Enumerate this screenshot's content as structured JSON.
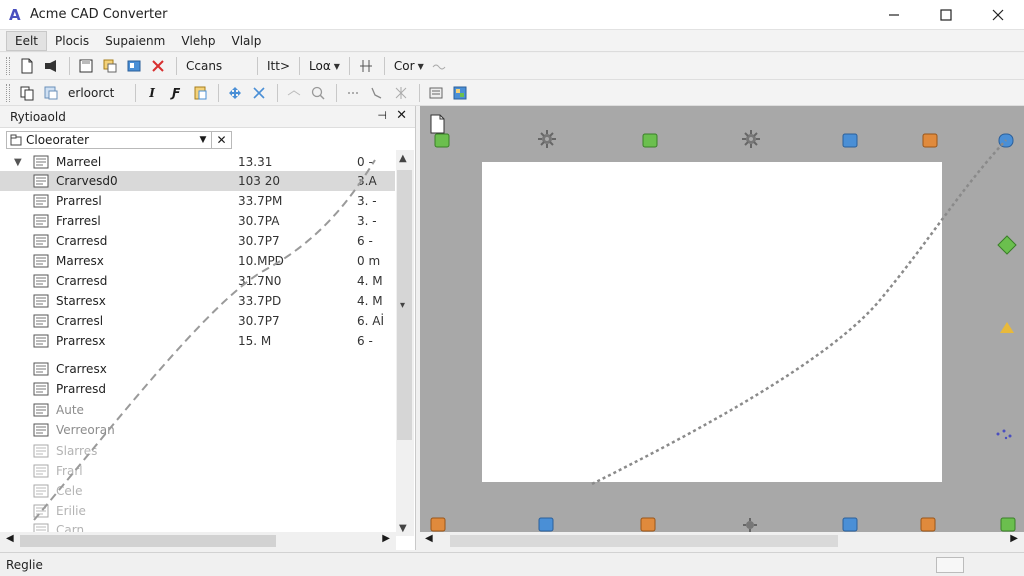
{
  "window": {
    "title": "Acme CAD Converter",
    "logo_glyph": "A",
    "accent": "#4a4fbf"
  },
  "menu": [
    {
      "label": "Eelt",
      "active": true
    },
    {
      "label": "Plocis"
    },
    {
      "label": "Supaienm"
    },
    {
      "label": "Vlehp"
    },
    {
      "label": "Vlalp"
    }
  ],
  "toolbar1": {
    "scans_label": "Ccans",
    "itt_label": "Itt>",
    "log_label": "Loα",
    "cor_label": "Cor"
  },
  "toolbar2": {
    "convert_label": "erloorct"
  },
  "panel": {
    "title": "Rytioaold",
    "combo_value": "Cloeorater"
  },
  "files": [
    {
      "name": "Marreel",
      "size": "13.31",
      "date": "0 –",
      "expander": "▼"
    },
    {
      "name": "Crarvesd0",
      "size": "103 20",
      "date": "3.A",
      "selected": true
    },
    {
      "name": "Prarresl",
      "size": "33.7PM",
      "date": "3. -"
    },
    {
      "name": "Frarresl",
      "size": "30.7PA",
      "date": "3. -"
    },
    {
      "name": "Crarresd",
      "size": "30.7P7",
      "date": "6 -"
    },
    {
      "name": "Marresx",
      "size": "10.MPD",
      "date": "0 m"
    },
    {
      "name": "Crarresd",
      "size": "31.7N0",
      "date": "4. M"
    },
    {
      "name": "Starresx",
      "size": "33.7PD",
      "date": "4. M"
    },
    {
      "name": "Crarresl",
      "size": "30.7P7",
      "date": "6. Aİ"
    },
    {
      "name": "Prarresx",
      "size": "15. M",
      "date": "6 -"
    },
    {
      "name": "Crarresx",
      "size": "",
      "date": ""
    },
    {
      "name": "Prarresd",
      "size": "",
      "date": ""
    },
    {
      "name": "Aute",
      "size": "",
      "date": "",
      "faded": 1
    },
    {
      "name": "Verreoran",
      "size": "",
      "date": "",
      "faded": 1
    },
    {
      "name": "Slarres",
      "size": "",
      "date": "",
      "faded": 2
    },
    {
      "name": "Frarl",
      "size": "",
      "date": "",
      "faded": 2
    },
    {
      "name": "Cele",
      "size": "",
      "date": "",
      "faded": 2
    },
    {
      "name": "Erilie",
      "size": "",
      "date": "",
      "faded": 2
    },
    {
      "name": "Carn",
      "size": "",
      "date": "",
      "faded": 2
    }
  ],
  "status": {
    "text": "Reglie"
  }
}
